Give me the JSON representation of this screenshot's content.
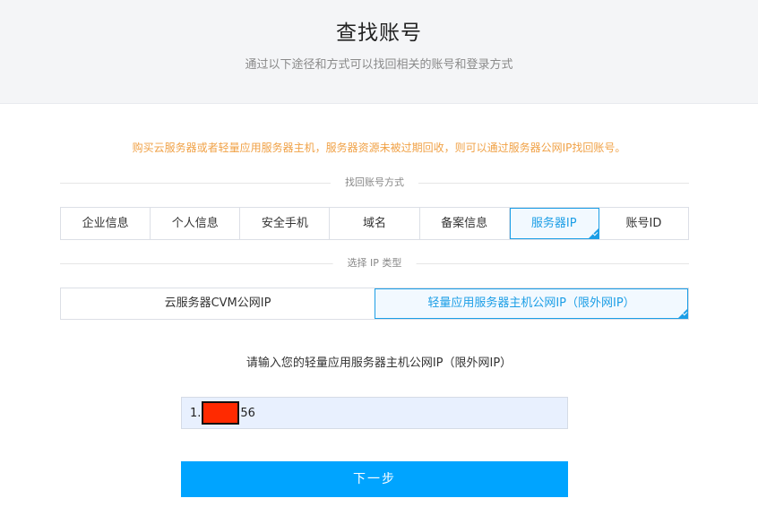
{
  "header": {
    "title": "查找账号",
    "subtitle": "通过以下途径和方式可以找回相关的账号和登录方式"
  },
  "notice": "购买云服务器或者轻量应用服务器主机，服务器资源未被过期回收，则可以通过服务器公网IP找回账号。",
  "recovery_method": {
    "label": "找回账号方式",
    "tabs": [
      {
        "label": "企业信息",
        "selected": false
      },
      {
        "label": "个人信息",
        "selected": false
      },
      {
        "label": "安全手机",
        "selected": false
      },
      {
        "label": "域名",
        "selected": false
      },
      {
        "label": "备案信息",
        "selected": false
      },
      {
        "label": "服务器IP",
        "selected": true
      },
      {
        "label": "账号ID",
        "selected": false
      }
    ]
  },
  "ip_type": {
    "label": "选择 IP 类型",
    "options": [
      {
        "label": "云服务器CVM公网IP",
        "selected": false
      },
      {
        "label": "轻量应用服务器主机公网IP（限外网IP）",
        "selected": true
      }
    ]
  },
  "ip_prompt": "请输入您的轻量应用服务器主机公网IP（限外网IP）",
  "ip_input": {
    "prefix": "1.",
    "suffix": "56"
  },
  "next_button": "下一步",
  "colors": {
    "accent": "#1c9ee6",
    "button": "#00a4ff",
    "notice": "#f0a146"
  }
}
